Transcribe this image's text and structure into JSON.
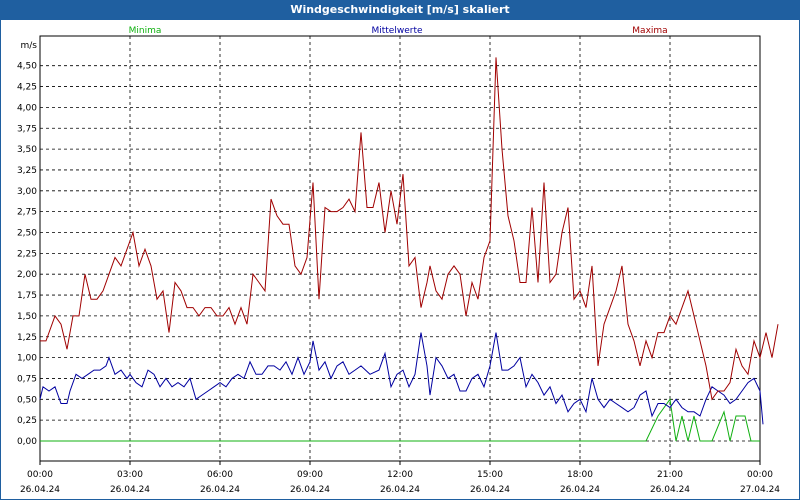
{
  "window": {
    "title": "Windgeschwindigkeit [m/s] skaliert"
  },
  "colors": {
    "titlebar": "#1f5fa0",
    "minima": "#10b010",
    "mittel": "#0000a0",
    "maxima": "#a00000",
    "grid": "#000000"
  },
  "chart_data": {
    "type": "line",
    "title": "Windgeschwindigkeit [m/s] skaliert",
    "ylabel": "m/s",
    "ylim": [
      -0.25,
      4.75
    ],
    "yticks": [
      "0,00",
      "0,25",
      "0,50",
      "0,75",
      "1,00",
      "1,25",
      "1,50",
      "1,75",
      "2,00",
      "2,25",
      "2,50",
      "2,75",
      "3,00",
      "3,25",
      "3,50",
      "3,75",
      "4,00",
      "4,25",
      "4,50"
    ],
    "ytick_values": [
      0,
      0.25,
      0.5,
      0.75,
      1.0,
      1.25,
      1.5,
      1.75,
      2.0,
      2.25,
      2.5,
      2.75,
      3.0,
      3.25,
      3.5,
      3.75,
      4.0,
      4.25,
      4.5
    ],
    "xlim": [
      0,
      24
    ],
    "xticks": [
      {
        "time": "00:00",
        "date": "26.04.24",
        "h": 0
      },
      {
        "time": "03:00",
        "date": "26.04.24",
        "h": 3
      },
      {
        "time": "06:00",
        "date": "26.04.24",
        "h": 6
      },
      {
        "time": "09:00",
        "date": "26.04.24",
        "h": 9
      },
      {
        "time": "12:00",
        "date": "26.04.24",
        "h": 12
      },
      {
        "time": "15:00",
        "date": "26.04.24",
        "h": 15
      },
      {
        "time": "18:00",
        "date": "26.04.24",
        "h": 18
      },
      {
        "time": "21:00",
        "date": "26.04.24",
        "h": 21
      },
      {
        "time": "00:00",
        "date": "27.04.24",
        "h": 24
      }
    ],
    "grid": true,
    "legend_position": "top",
    "series": [
      {
        "name": "Minima",
        "color": "#10b010",
        "points": [
          [
            0,
            0
          ],
          [
            20.2,
            0
          ],
          [
            20.6,
            0.3
          ],
          [
            21.0,
            0.5
          ],
          [
            21.2,
            0
          ],
          [
            21.4,
            0.3
          ],
          [
            21.6,
            0
          ],
          [
            21.8,
            0.3
          ],
          [
            22.0,
            0
          ],
          [
            22.4,
            0
          ],
          [
            22.8,
            0.35
          ],
          [
            23.0,
            0
          ],
          [
            23.2,
            0.3
          ],
          [
            23.5,
            0.3
          ],
          [
            23.7,
            0
          ],
          [
            24,
            0
          ]
        ]
      },
      {
        "name": "Mittelwerte",
        "color": "#0000a0",
        "points": [
          [
            0,
            0.5
          ],
          [
            0.1,
            0.65
          ],
          [
            0.3,
            0.6
          ],
          [
            0.5,
            0.65
          ],
          [
            0.7,
            0.45
          ],
          [
            0.9,
            0.45
          ],
          [
            1.0,
            0.6
          ],
          [
            1.2,
            0.8
          ],
          [
            1.4,
            0.75
          ],
          [
            1.6,
            0.8
          ],
          [
            1.8,
            0.85
          ],
          [
            2.0,
            0.85
          ],
          [
            2.2,
            0.9
          ],
          [
            2.3,
            1.0
          ],
          [
            2.5,
            0.8
          ],
          [
            2.7,
            0.85
          ],
          [
            2.9,
            0.75
          ],
          [
            3.0,
            0.8
          ],
          [
            3.2,
            0.7
          ],
          [
            3.4,
            0.65
          ],
          [
            3.6,
            0.85
          ],
          [
            3.8,
            0.8
          ],
          [
            4.0,
            0.65
          ],
          [
            4.2,
            0.75
          ],
          [
            4.4,
            0.65
          ],
          [
            4.6,
            0.7
          ],
          [
            4.8,
            0.65
          ],
          [
            5.0,
            0.75
          ],
          [
            5.2,
            0.5
          ],
          [
            5.4,
            0.55
          ],
          [
            5.6,
            0.6
          ],
          [
            5.8,
            0.65
          ],
          [
            6.0,
            0.7
          ],
          [
            6.2,
            0.65
          ],
          [
            6.4,
            0.75
          ],
          [
            6.6,
            0.8
          ],
          [
            6.8,
            0.75
          ],
          [
            7.0,
            0.95
          ],
          [
            7.2,
            0.8
          ],
          [
            7.4,
            0.8
          ],
          [
            7.6,
            0.9
          ],
          [
            7.8,
            0.9
          ],
          [
            8.0,
            0.85
          ],
          [
            8.2,
            0.95
          ],
          [
            8.4,
            0.8
          ],
          [
            8.6,
            1.0
          ],
          [
            8.8,
            0.8
          ],
          [
            9.0,
            0.95
          ],
          [
            9.1,
            1.2
          ],
          [
            9.3,
            0.85
          ],
          [
            9.5,
            0.95
          ],
          [
            9.7,
            0.75
          ],
          [
            9.9,
            0.9
          ],
          [
            10.1,
            0.95
          ],
          [
            10.3,
            0.8
          ],
          [
            10.5,
            0.85
          ],
          [
            10.7,
            0.9
          ],
          [
            11.0,
            0.8
          ],
          [
            11.3,
            0.85
          ],
          [
            11.5,
            1.05
          ],
          [
            11.7,
            0.65
          ],
          [
            11.9,
            0.8
          ],
          [
            12.1,
            0.85
          ],
          [
            12.3,
            0.65
          ],
          [
            12.5,
            0.8
          ],
          [
            12.7,
            1.3
          ],
          [
            12.9,
            0.9
          ],
          [
            13.0,
            0.55
          ],
          [
            13.2,
            1.0
          ],
          [
            13.4,
            0.9
          ],
          [
            13.6,
            0.75
          ],
          [
            13.8,
            0.8
          ],
          [
            14.0,
            0.6
          ],
          [
            14.2,
            0.6
          ],
          [
            14.4,
            0.75
          ],
          [
            14.6,
            0.8
          ],
          [
            14.8,
            0.65
          ],
          [
            15.0,
            0.9
          ],
          [
            15.2,
            1.3
          ],
          [
            15.4,
            0.85
          ],
          [
            15.6,
            0.85
          ],
          [
            15.8,
            0.9
          ],
          [
            16.0,
            1.0
          ],
          [
            16.2,
            0.65
          ],
          [
            16.4,
            0.8
          ],
          [
            16.6,
            0.7
          ],
          [
            16.8,
            0.55
          ],
          [
            17.0,
            0.65
          ],
          [
            17.2,
            0.45
          ],
          [
            17.4,
            0.55
          ],
          [
            17.6,
            0.35
          ],
          [
            17.8,
            0.45
          ],
          [
            18.0,
            0.5
          ],
          [
            18.2,
            0.35
          ],
          [
            18.4,
            0.75
          ],
          [
            18.6,
            0.5
          ],
          [
            18.8,
            0.4
          ],
          [
            19.0,
            0.5
          ],
          [
            19.2,
            0.45
          ],
          [
            19.4,
            0.4
          ],
          [
            19.6,
            0.35
          ],
          [
            19.8,
            0.4
          ],
          [
            20.0,
            0.55
          ],
          [
            20.2,
            0.6
          ],
          [
            20.4,
            0.3
          ],
          [
            20.6,
            0.45
          ],
          [
            20.8,
            0.45
          ],
          [
            21.0,
            0.4
          ],
          [
            21.2,
            0.5
          ],
          [
            21.4,
            0.4
          ],
          [
            21.6,
            0.35
          ],
          [
            21.8,
            0.35
          ],
          [
            22.0,
            0.3
          ],
          [
            22.2,
            0.5
          ],
          [
            22.4,
            0.65
          ],
          [
            22.6,
            0.6
          ],
          [
            22.8,
            0.55
          ],
          [
            23.0,
            0.45
          ],
          [
            23.2,
            0.5
          ],
          [
            23.4,
            0.6
          ],
          [
            23.6,
            0.7
          ],
          [
            23.8,
            0.75
          ],
          [
            24,
            0.6
          ],
          [
            24.1,
            0.2
          ]
        ]
      },
      {
        "name": "Maxima",
        "color": "#a00000",
        "points": [
          [
            0,
            1.2
          ],
          [
            0.2,
            1.2
          ],
          [
            0.5,
            1.5
          ],
          [
            0.7,
            1.4
          ],
          [
            0.9,
            1.1
          ],
          [
            1.1,
            1.5
          ],
          [
            1.3,
            1.5
          ],
          [
            1.5,
            2.0
          ],
          [
            1.7,
            1.7
          ],
          [
            1.9,
            1.7
          ],
          [
            2.1,
            1.8
          ],
          [
            2.3,
            2.0
          ],
          [
            2.5,
            2.2
          ],
          [
            2.7,
            2.1
          ],
          [
            2.9,
            2.3
          ],
          [
            3.1,
            2.5
          ],
          [
            3.3,
            2.1
          ],
          [
            3.5,
            2.3
          ],
          [
            3.7,
            2.1
          ],
          [
            3.9,
            1.7
          ],
          [
            4.1,
            1.8
          ],
          [
            4.3,
            1.3
          ],
          [
            4.5,
            1.9
          ],
          [
            4.7,
            1.8
          ],
          [
            4.9,
            1.6
          ],
          [
            5.1,
            1.6
          ],
          [
            5.3,
            1.5
          ],
          [
            5.5,
            1.6
          ],
          [
            5.7,
            1.6
          ],
          [
            5.9,
            1.5
          ],
          [
            6.1,
            1.5
          ],
          [
            6.3,
            1.6
          ],
          [
            6.5,
            1.4
          ],
          [
            6.7,
            1.6
          ],
          [
            6.9,
            1.4
          ],
          [
            7.1,
            2.0
          ],
          [
            7.3,
            1.9
          ],
          [
            7.5,
            1.8
          ],
          [
            7.7,
            2.9
          ],
          [
            7.9,
            2.7
          ],
          [
            8.1,
            2.6
          ],
          [
            8.3,
            2.6
          ],
          [
            8.5,
            2.1
          ],
          [
            8.7,
            2.0
          ],
          [
            8.9,
            2.2
          ],
          [
            9.1,
            3.1
          ],
          [
            9.3,
            1.7
          ],
          [
            9.5,
            2.8
          ],
          [
            9.7,
            2.75
          ],
          [
            9.9,
            2.75
          ],
          [
            10.1,
            2.8
          ],
          [
            10.3,
            2.9
          ],
          [
            10.5,
            2.75
          ],
          [
            10.7,
            3.7
          ],
          [
            10.9,
            2.8
          ],
          [
            11.1,
            2.8
          ],
          [
            11.3,
            3.1
          ],
          [
            11.5,
            2.5
          ],
          [
            11.7,
            3.0
          ],
          [
            11.9,
            2.6
          ],
          [
            12.1,
            3.2
          ],
          [
            12.3,
            2.1
          ],
          [
            12.5,
            2.2
          ],
          [
            12.7,
            1.6
          ],
          [
            12.9,
            1.9
          ],
          [
            13.0,
            2.1
          ],
          [
            13.2,
            1.8
          ],
          [
            13.4,
            1.7
          ],
          [
            13.6,
            2.0
          ],
          [
            13.8,
            2.1
          ],
          [
            14.0,
            2.0
          ],
          [
            14.2,
            1.5
          ],
          [
            14.4,
            1.9
          ],
          [
            14.6,
            1.7
          ],
          [
            14.8,
            2.2
          ],
          [
            15.0,
            2.4
          ],
          [
            15.2,
            4.6
          ],
          [
            15.4,
            3.5
          ],
          [
            15.6,
            2.7
          ],
          [
            15.8,
            2.4
          ],
          [
            16.0,
            1.9
          ],
          [
            16.2,
            1.9
          ],
          [
            16.4,
            2.8
          ],
          [
            16.6,
            1.9
          ],
          [
            16.8,
            3.1
          ],
          [
            17.0,
            1.9
          ],
          [
            17.2,
            2.0
          ],
          [
            17.4,
            2.5
          ],
          [
            17.6,
            2.8
          ],
          [
            17.8,
            1.7
          ],
          [
            18.0,
            1.8
          ],
          [
            18.2,
            1.6
          ],
          [
            18.4,
            2.1
          ],
          [
            18.6,
            0.9
          ],
          [
            18.8,
            1.4
          ],
          [
            19.0,
            1.6
          ],
          [
            19.2,
            1.8
          ],
          [
            19.4,
            2.1
          ],
          [
            19.6,
            1.4
          ],
          [
            19.8,
            1.2
          ],
          [
            20.0,
            0.9
          ],
          [
            20.2,
            1.2
          ],
          [
            20.4,
            1.0
          ],
          [
            20.6,
            1.3
          ],
          [
            20.8,
            1.3
          ],
          [
            21.0,
            1.5
          ],
          [
            21.2,
            1.4
          ],
          [
            21.4,
            1.6
          ],
          [
            21.6,
            1.8
          ],
          [
            21.8,
            1.5
          ],
          [
            22.0,
            1.2
          ],
          [
            22.2,
            0.9
          ],
          [
            22.4,
            0.5
          ],
          [
            22.6,
            0.6
          ],
          [
            22.8,
            0.6
          ],
          [
            23.0,
            0.7
          ],
          [
            23.2,
            1.1
          ],
          [
            23.4,
            0.9
          ],
          [
            23.6,
            0.8
          ],
          [
            23.8,
            1.2
          ],
          [
            24.0,
            1.0
          ],
          [
            24.2,
            1.3
          ],
          [
            24.4,
            1.0
          ],
          [
            24.6,
            1.4
          ]
        ]
      }
    ]
  }
}
